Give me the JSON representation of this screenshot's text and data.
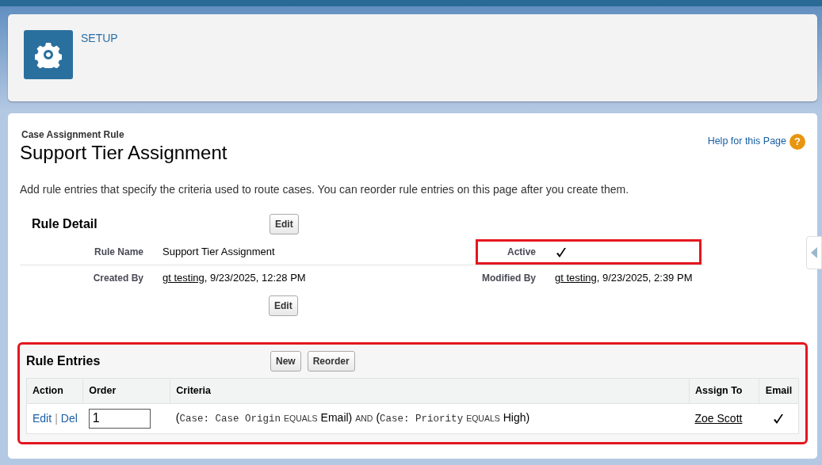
{
  "header": {
    "title": "SETUP"
  },
  "page": {
    "object_label": "Case Assignment Rule",
    "title": "Support Tier Assignment",
    "help_link": "Help for this Page",
    "help_icon": "?",
    "description": "Add rule entries that specify the criteria used to route cases. You can reorder rule entries on this page after you create them."
  },
  "rule_detail": {
    "title": "Rule Detail",
    "top_button": "Edit",
    "bottom_button": "Edit",
    "fields": [
      {
        "label": "Rule Name",
        "kind": "text",
        "value": "Support Tier Assignment"
      },
      {
        "label": "Active",
        "kind": "checkbox",
        "checked": true,
        "highlighted": true
      },
      {
        "label": "Created By",
        "kind": "user",
        "user": "gt testing",
        "value": ", 9/23/2025, 12:28 PM"
      },
      {
        "label": "Modified By",
        "kind": "user",
        "user": "gt testing",
        "value": ", 9/23/2025, 2:39 PM"
      }
    ]
  },
  "rule_entries": {
    "title": "Rule Entries",
    "highlighted": true,
    "buttons": [
      "New",
      "Reorder"
    ],
    "columns": [
      "Action",
      "Order",
      "Criteria",
      "Assign To",
      "Email"
    ],
    "rows": [
      {
        "actions": [
          "Edit",
          "Del"
        ],
        "separator": "|",
        "order": "1",
        "criteria": [
          {
            "kind": "plain",
            "text": "("
          },
          {
            "kind": "mono",
            "text": "Case: Case Origin"
          },
          {
            "kind": "op",
            "text": "EQUALS"
          },
          {
            "kind": "plain",
            "text": "Email)"
          },
          {
            "kind": "op",
            "text": "AND"
          },
          {
            "kind": "plain",
            "text": "("
          },
          {
            "kind": "mono",
            "text": "Case: Priority"
          },
          {
            "kind": "op",
            "text": "EQUALS"
          },
          {
            "kind": "plain",
            "text": "High)"
          }
        ],
        "assign_to": "Zoe Scott",
        "email": true
      }
    ]
  }
}
